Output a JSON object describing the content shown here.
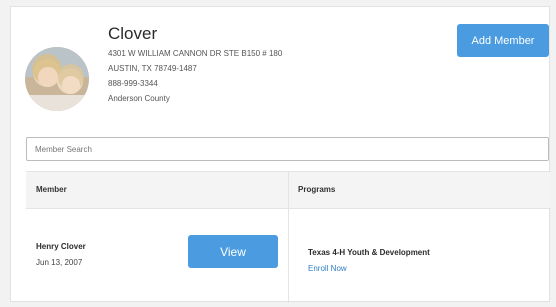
{
  "club": {
    "name": "Clover",
    "address_line1": "4301 W WILLIAM CANNON DR STE B150 # 180",
    "address_line2": "AUSTIN, TX 78749-1487",
    "phone": "888-999-3344",
    "county": "Anderson County",
    "add_member_label": "Add Member"
  },
  "search": {
    "placeholder": "Member Search",
    "value": ""
  },
  "table": {
    "headers": {
      "member": "Member",
      "programs": "Programs"
    },
    "rows": [
      {
        "member_name": "Henry Clover",
        "member_date": "Jun 13, 2007",
        "view_label": "View",
        "program_name": "Texas 4-H Youth & Development",
        "enroll_label": "Enroll Now"
      }
    ]
  },
  "colors": {
    "accent": "#4a9be0",
    "link": "#2f7fc8"
  }
}
